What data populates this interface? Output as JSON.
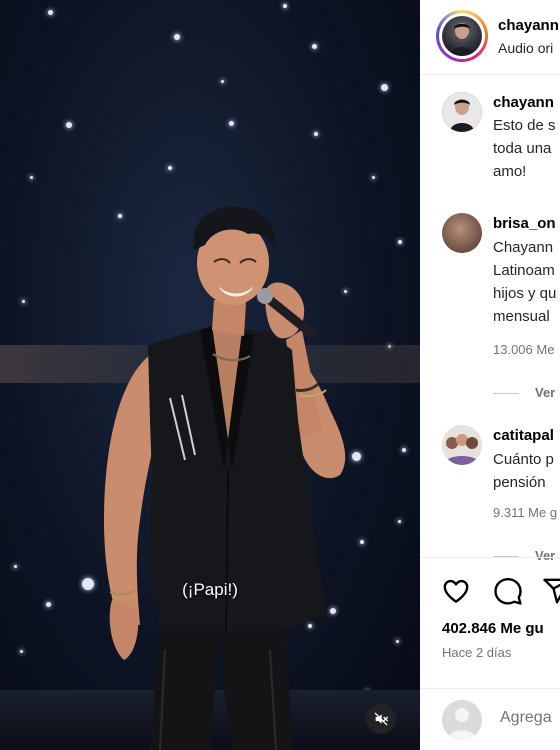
{
  "video": {
    "subtitle": "(¡Papi!)",
    "mute_icon": "speaker-muted-icon"
  },
  "header": {
    "username": "chayann",
    "audio_label": "Audio ori"
  },
  "caption": {
    "username": "chayann",
    "lines": [
      "Esto de s",
      "toda una",
      "amo!"
    ]
  },
  "comments": [
    {
      "username": "brisa_on",
      "lines": [
        "Chayann",
        "Latinoam",
        "hijos y qu",
        "mensual"
      ],
      "meta": "13.006 Me",
      "replies_label": "Ver"
    },
    {
      "username": "catitapal",
      "lines": [
        "Cuánto p",
        "pensión"
      ],
      "meta": "9.311 Me g",
      "replies_label": "Ver"
    }
  ],
  "actions": {
    "icons": [
      "heart-icon",
      "comment-icon",
      "share-icon"
    ]
  },
  "stats": {
    "likes": "402.846 Me gu",
    "time_ago": "Hace 2 días"
  },
  "composer": {
    "placeholder": "Agrega"
  }
}
